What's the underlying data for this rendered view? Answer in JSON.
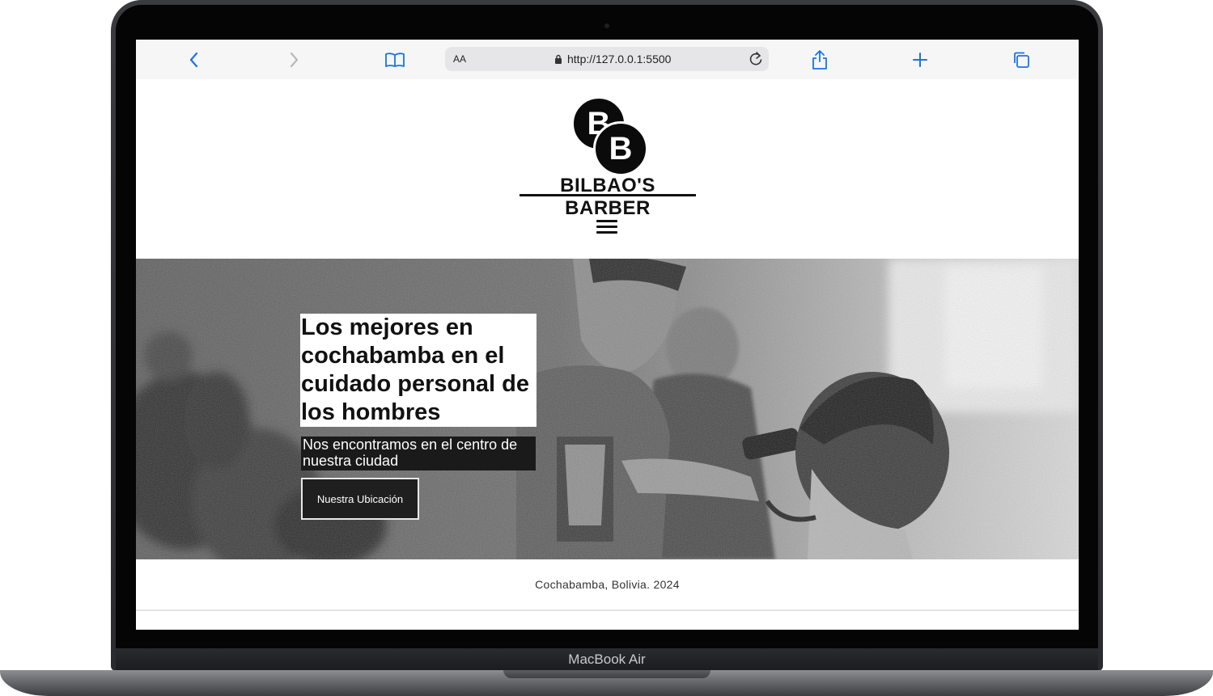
{
  "device": {
    "label": "MacBook Air"
  },
  "browser": {
    "text_size_label": "AA",
    "url": "http://127.0.0.1:5500",
    "icons": [
      "back-icon",
      "forward-icon",
      "bookmarks-icon",
      "lock-icon",
      "reload-icon",
      "share-icon",
      "new-tab-icon",
      "tabs-icon"
    ]
  },
  "site": {
    "logo_monogram": "BB",
    "brand": "BILBAO'S BARBER",
    "menu_icon": "hamburger-icon"
  },
  "hero": {
    "title": "Los mejores en cochabamba en el cuidado personal de los hombres",
    "subtitle": "Nos encontramos en el centro de nuestra ciudad",
    "button_label": "Nuestra Ubicación"
  },
  "footer": {
    "text": "Cochabamba, Bolivia. 2024"
  },
  "colors": {
    "accent_blue": "#1a73e8",
    "dark": "#111111",
    "toolbar_bg": "#f6f6f7"
  }
}
